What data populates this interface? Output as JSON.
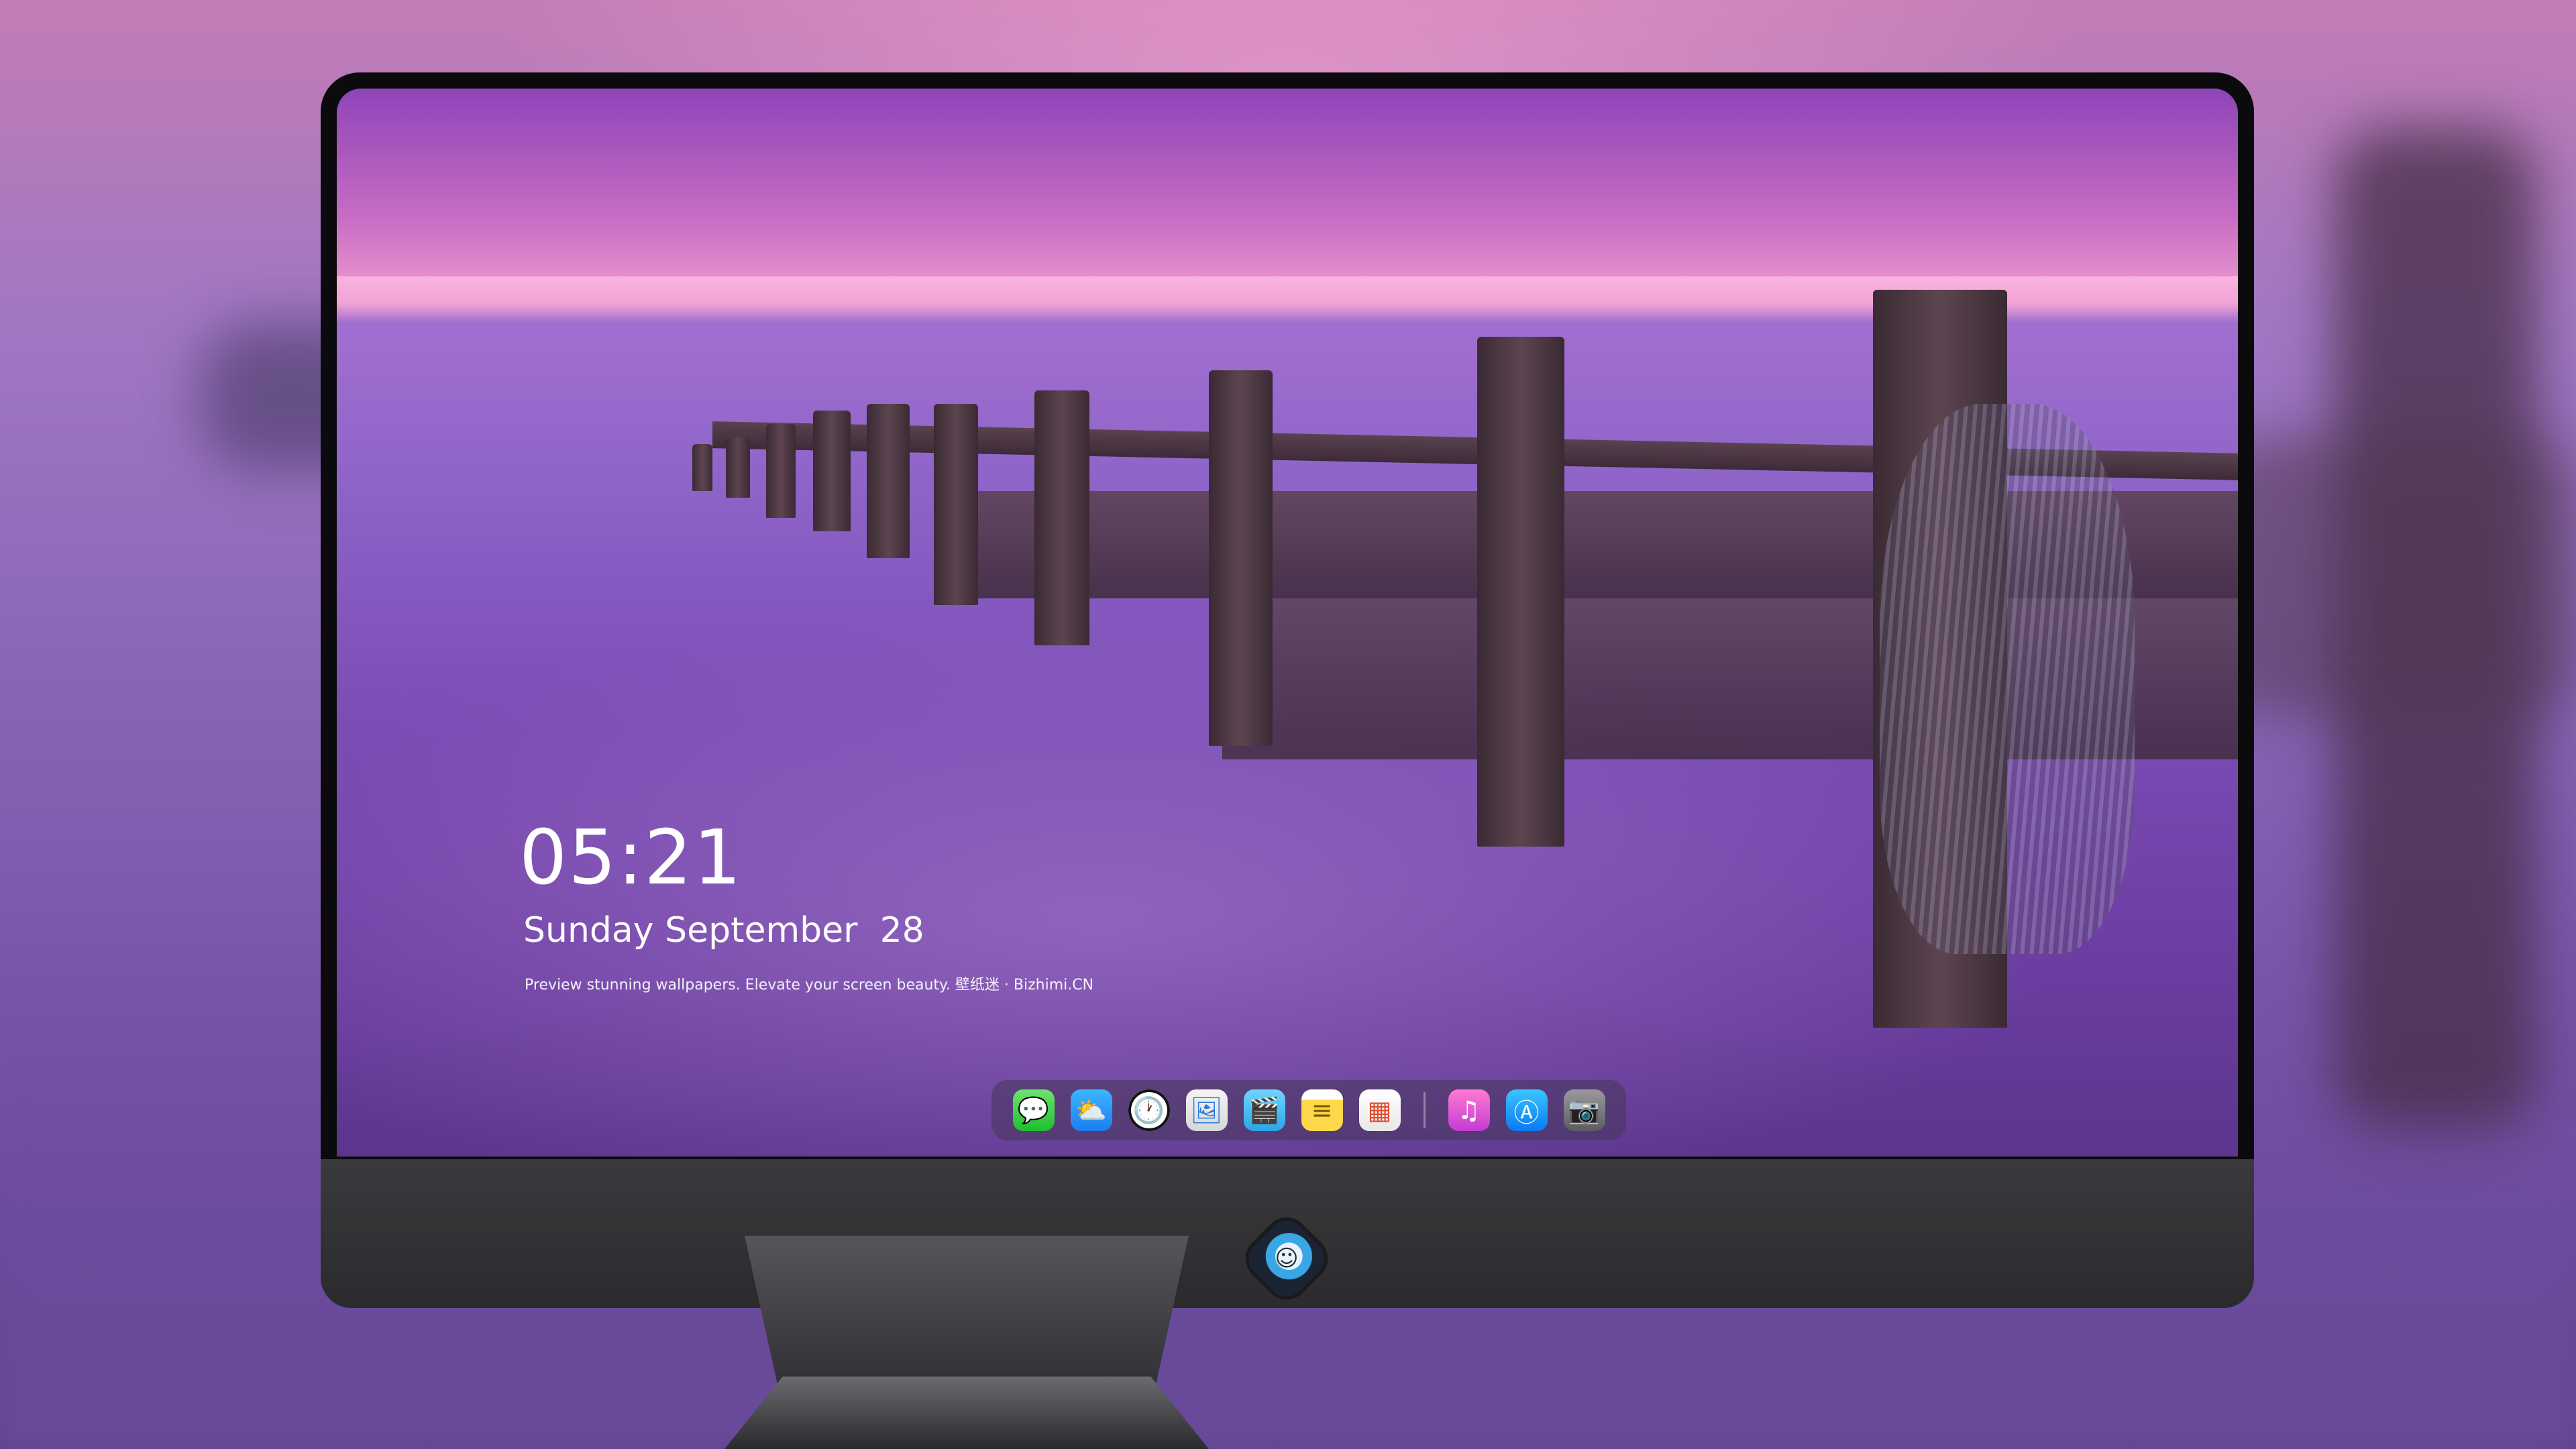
{
  "lockscreen": {
    "time": "05:21",
    "date": "Sunday September  28",
    "tagline": "Preview stunning wallpapers. Elevate your screen beauty. 壁纸迷 · Bizhimi.CN"
  },
  "dock": {
    "apps": [
      {
        "name": "messages-icon",
        "glyph": "💬"
      },
      {
        "name": "weather-icon",
        "glyph": "⛅"
      },
      {
        "name": "clock-icon",
        "glyph": "🕐"
      },
      {
        "name": "preview-icon",
        "glyph": "🖼"
      },
      {
        "name": "clips-icon",
        "glyph": "🎬"
      },
      {
        "name": "notes-icon",
        "glyph": "≡"
      },
      {
        "name": "photos-icon",
        "glyph": "▦"
      },
      {
        "name": "music-icon",
        "glyph": "♫"
      },
      {
        "name": "app-store-icon",
        "glyph": "Ⓐ"
      },
      {
        "name": "camera-icon",
        "glyph": "📷"
      }
    ]
  },
  "monitor": {
    "chin_logo": "brand-logo-icon"
  },
  "colors": {
    "sky_top": "#8e44b8",
    "horizon": "#ee9ccf",
    "sea": "#7a4cb4",
    "bezel": "#0b0b0d",
    "chin": "#3a3a3d"
  }
}
